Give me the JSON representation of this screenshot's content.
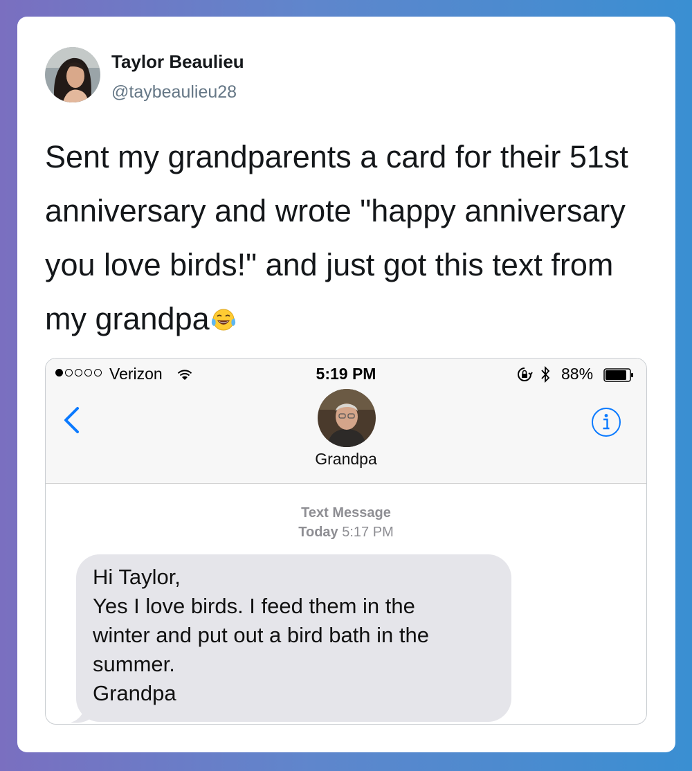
{
  "tweet": {
    "display_name": "Taylor Beaulieu",
    "handle": "@taybeaulieu28",
    "text": "Sent my grandparents a card for their 51st anniversary and wrote \"happy anniversary you love birds!\" and just got this text from my grandpa",
    "emoji_icon": "face-with-tears-of-joy-icon"
  },
  "phone": {
    "status_bar": {
      "carrier": "Verizon",
      "time": "5:19 PM",
      "battery": "88%",
      "signal_bars_filled": 1,
      "signal_bars_total": 5
    },
    "contact": {
      "name": "Grandpa"
    },
    "conversation": {
      "type_label": "Text Message",
      "day_label": "Today",
      "time_label": "5:17 PM"
    },
    "message": {
      "lines": [
        "Hi Taylor,",
        "Yes I love birds. I feed them in the",
        "winter and put out a bird bath in the",
        "summer.",
        "Grandpa"
      ]
    },
    "colors": {
      "ios_blue": "#0a7aff",
      "bubble_gray": "#e5e5ea"
    }
  }
}
